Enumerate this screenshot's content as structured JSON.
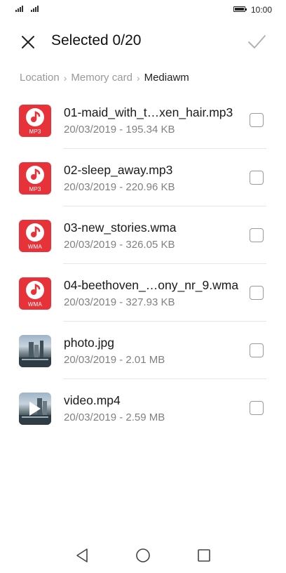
{
  "status_bar": {
    "time": "10:00",
    "sim1_icon": "signal-icon",
    "sim2_icon": "signal-icon",
    "battery_icon": "battery-icon"
  },
  "header": {
    "title": "Selected 0/20",
    "close_icon": "close-icon",
    "confirm_icon": "checkmark-icon"
  },
  "breadcrumb": {
    "items": [
      "Location",
      "Memory card",
      "Mediawm"
    ]
  },
  "files": [
    {
      "name": "01-maid_with_t…xen_hair.mp3",
      "meta": "20/03/2019 - 195.34 KB",
      "type": "audio",
      "badge": "MP3",
      "checked": false
    },
    {
      "name": "02-sleep_away.mp3",
      "meta": "20/03/2019 - 220.96 KB",
      "type": "audio",
      "badge": "MP3",
      "checked": false
    },
    {
      "name": "03-new_stories.wma",
      "meta": "20/03/2019 - 326.05 KB",
      "type": "audio",
      "badge": "WMA",
      "checked": false
    },
    {
      "name": "04-beethoven_…ony_nr_9.wma",
      "meta": "20/03/2019 - 327.93 KB",
      "type": "audio",
      "badge": "WMA",
      "checked": false
    },
    {
      "name": "photo.jpg",
      "meta": "20/03/2019 - 2.01 MB",
      "type": "image",
      "checked": false
    },
    {
      "name": "video.mp4",
      "meta": "20/03/2019 - 2.59 MB",
      "type": "video",
      "checked": false
    }
  ],
  "nav_bar": {
    "back_icon": "back-triangle-icon",
    "home_icon": "home-circle-icon",
    "recent_icon": "recent-apps-square-icon"
  },
  "colors": {
    "audio_icon_bg": "#e8323a",
    "text_primary": "#1a1a1a",
    "text_secondary": "#808080"
  }
}
